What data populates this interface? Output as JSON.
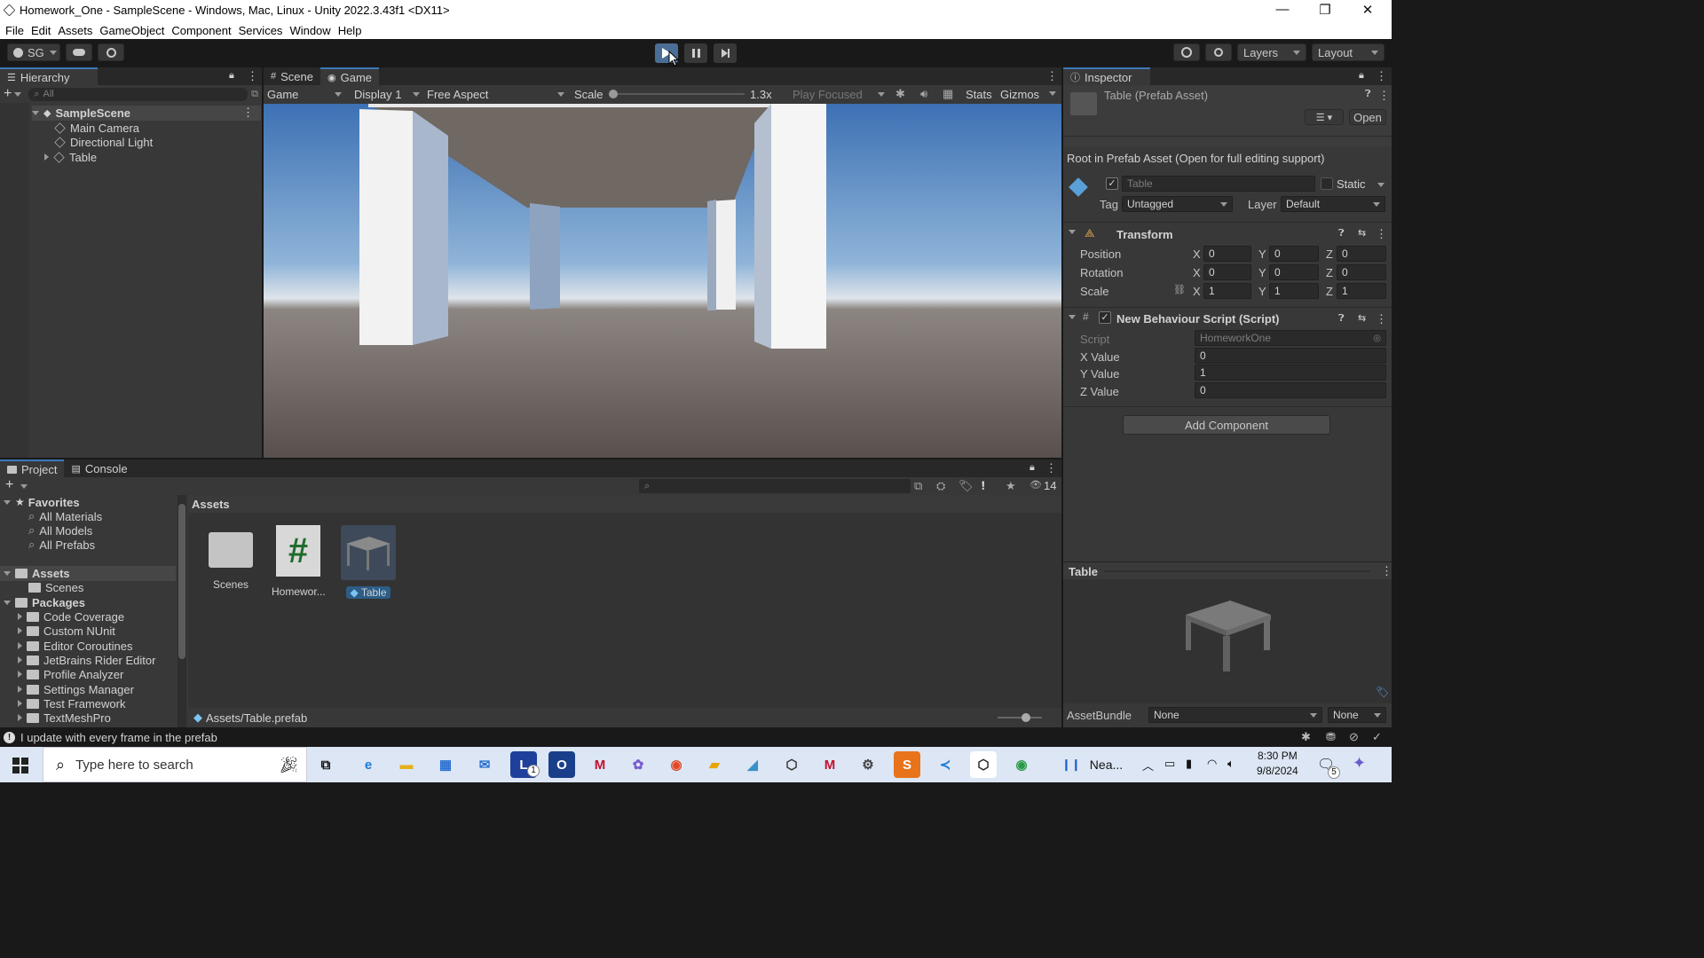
{
  "window": {
    "title": "Homework_One - SampleScene - Windows, Mac, Linux - Unity 2022.3.43f1 <DX11>",
    "min": "—",
    "max": "❐",
    "close": "✕"
  },
  "menu": [
    "File",
    "Edit",
    "Assets",
    "GameObject",
    "Component",
    "Services",
    "Window",
    "Help"
  ],
  "toolbar": {
    "account": "SG",
    "layers": "Layers",
    "layout": "Layout"
  },
  "hierarchy": {
    "tab": "Hierarchy",
    "search_placeholder": "All",
    "scene": "SampleScene",
    "items": [
      "Main Camera",
      "Directional Light",
      "Table"
    ]
  },
  "view_tabs": {
    "scene": "Scene",
    "game": "Game"
  },
  "game_bar": {
    "mode": "Game",
    "display": "Display 1",
    "aspect": "Free Aspect",
    "scale_label": "Scale",
    "scale_value": "1.3x",
    "play_focused": "Play Focused",
    "stats": "Stats",
    "gizmos": "Gizmos"
  },
  "inspector": {
    "tab": "Inspector",
    "asset_title": "Table (Prefab Asset)",
    "open": "Open",
    "root_note": "Root in Prefab Asset (Open for full editing support)",
    "name": "Table",
    "static": "Static",
    "tag_label": "Tag",
    "tag": "Untagged",
    "layer_label": "Layer",
    "layer": "Default",
    "transform": {
      "title": "Transform",
      "rows": [
        {
          "label": "Position",
          "x": "0",
          "y": "0",
          "z": "0"
        },
        {
          "label": "Rotation",
          "x": "0",
          "y": "0",
          "z": "0"
        },
        {
          "label": "Scale",
          "x": "1",
          "y": "1",
          "z": "1"
        }
      ]
    },
    "script": {
      "title": "New Behaviour Script (Script)",
      "script_label": "Script",
      "script_value": "HomeworkOne",
      "fields": [
        {
          "label": "X Value",
          "value": "0"
        },
        {
          "label": "Y Value",
          "value": "1"
        },
        {
          "label": "Z Value",
          "value": "0"
        }
      ]
    },
    "add_component": "Add Component",
    "preview_title": "Table",
    "assetbundle_label": "AssetBundle",
    "assetbundle": "None",
    "variant": "None"
  },
  "project": {
    "tabs": [
      "Project",
      "Console"
    ],
    "count": "14",
    "favorites_label": "Favorites",
    "favorites": [
      "All Materials",
      "All Models",
      "All Prefabs"
    ],
    "assets_label": "Assets",
    "assets_children": [
      "Scenes"
    ],
    "packages_label": "Packages",
    "packages": [
      "Code Coverage",
      "Custom NUnit",
      "Editor Coroutines",
      "JetBrains Rider Editor",
      "Profile Analyzer",
      "Settings Manager",
      "Test Framework",
      "TextMeshPro"
    ],
    "breadcrumb": "Assets",
    "items": [
      "Scenes",
      "Homewor...",
      "Table"
    ],
    "path": "Assets/Table.prefab"
  },
  "status": {
    "message": "I update with every frame in the prefab"
  },
  "taskbar": {
    "search": "Type here to search",
    "weather": "Nea...",
    "time": "8:30 PM",
    "date": "9/8/2024",
    "notif": "5",
    "l_badge": "1"
  }
}
